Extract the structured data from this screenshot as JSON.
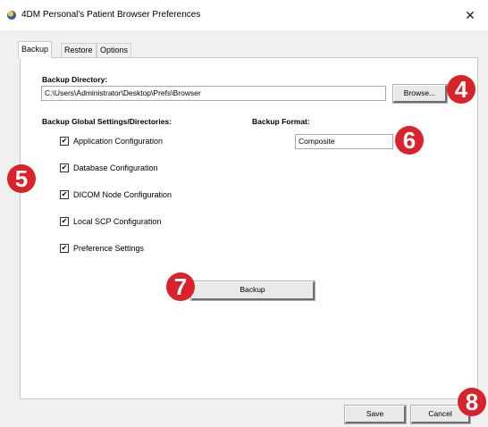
{
  "window": {
    "title": "4DM Personal's Patient Browser Preferences",
    "close_glyph": "✕"
  },
  "tabs": [
    {
      "label": "Backup",
      "active": true
    },
    {
      "label": "Restore",
      "active": false
    },
    {
      "label": "Options",
      "active": false
    }
  ],
  "backup": {
    "directory_label": "Backup Directory:",
    "directory_value": "C:\\Users\\Administrator\\Desktop\\Prefs\\Browser",
    "browse_label": "Browse...",
    "global_label": "Backup Global Settings/Directories:",
    "format_label": "Backup Format:",
    "format_value": "Composite",
    "items": [
      {
        "label": "Application Configuration",
        "checked": true
      },
      {
        "label": "Database Configuration",
        "checked": true
      },
      {
        "label": "DICOM Node Configuration",
        "checked": true
      },
      {
        "label": "Local SCP Configuration",
        "checked": true
      },
      {
        "label": "Preference Settings",
        "checked": true
      }
    ],
    "backup_button": "Backup"
  },
  "footer": {
    "save_label": "Save",
    "cancel_label": "Cancel"
  },
  "callouts": [
    "4",
    "5",
    "6",
    "7",
    "8"
  ],
  "check_glyph": "✔",
  "colors": {
    "callout_red": "#d9222a",
    "window_bg": "#f0f0f0"
  }
}
